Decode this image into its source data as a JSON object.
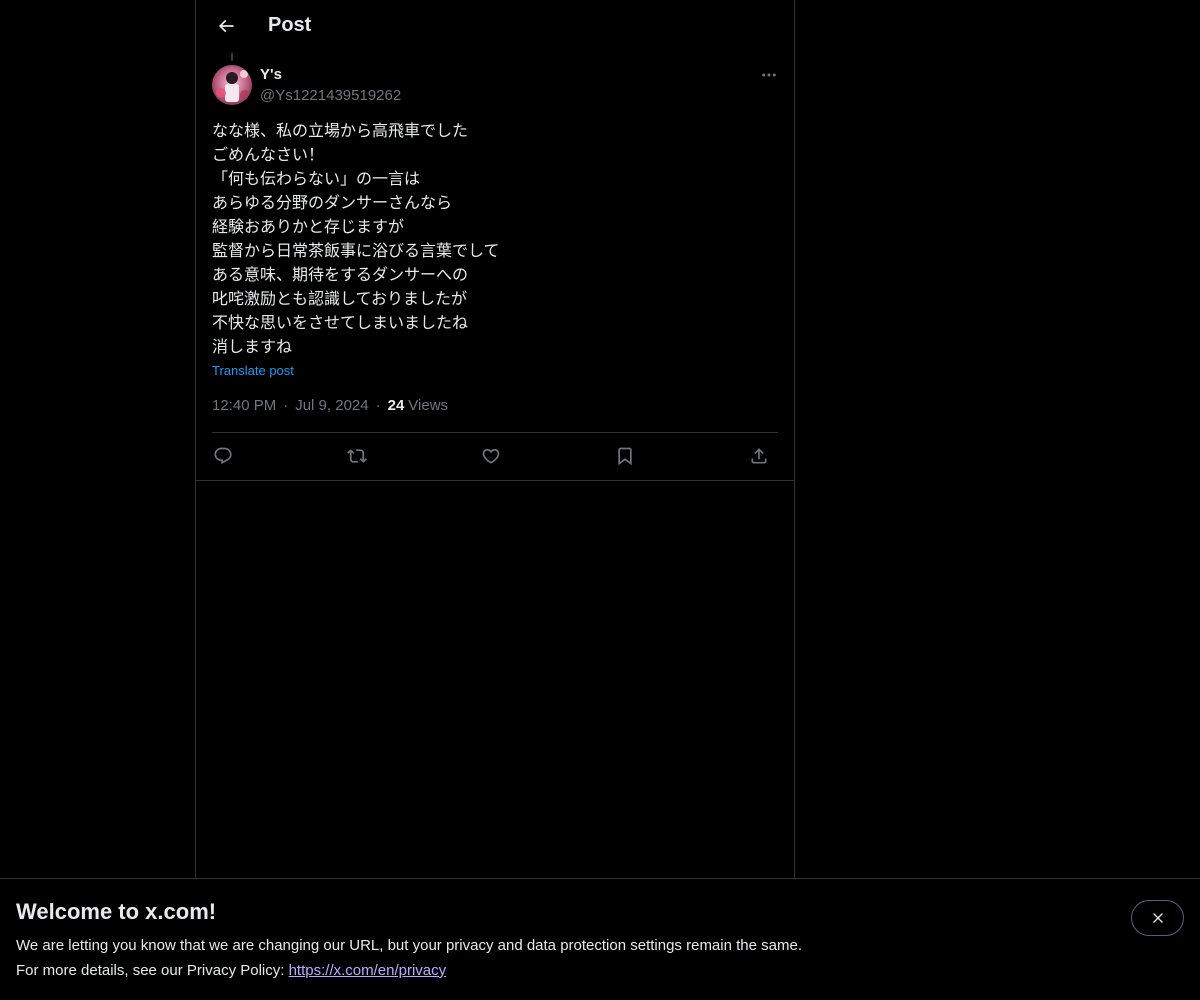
{
  "header": {
    "title": "Post",
    "back_icon": "arrow-left-icon"
  },
  "post": {
    "display_name": "Y's",
    "handle": "@Ys1221439519262",
    "avatar": "avatar-image",
    "lines": [
      "なな様、私の立場から高飛車でした",
      "ごめんなさい！",
      "「何も伝わらない」の一言は",
      "あらゆる分野のダンサーさんなら",
      "経験おありかと存じますが",
      "監督から日常茶飯事に浴びる言葉でして",
      "ある意味、期待をするダンサーへの",
      "叱咤激励とも認識しておりましたが",
      "不快な思いをさせてしまいましたね",
      "消しますね"
    ],
    "translate_label": "Translate post",
    "time": "12:40 PM",
    "date": "Jul 9, 2024",
    "separator": "·",
    "views_count": "24",
    "views_label": "Views"
  },
  "actions": [
    {
      "name": "reply-icon"
    },
    {
      "name": "repost-icon"
    },
    {
      "name": "like-icon"
    },
    {
      "name": "bookmark-icon"
    },
    {
      "name": "share-icon"
    }
  ],
  "banner": {
    "title": "Welcome to x.com!",
    "line1": "We are letting you know that we are changing our URL, but your privacy and data protection settings remain the same.",
    "line2_prefix": "For more details, see our Privacy Policy: ",
    "link": "https://x.com/en/privacy",
    "close_icon": "close-icon"
  },
  "colors": {
    "background": "#000000",
    "text": "#e7e9ea",
    "secondary": "#71767b",
    "accent": "#1d9bf0",
    "border": "#2f3336"
  }
}
